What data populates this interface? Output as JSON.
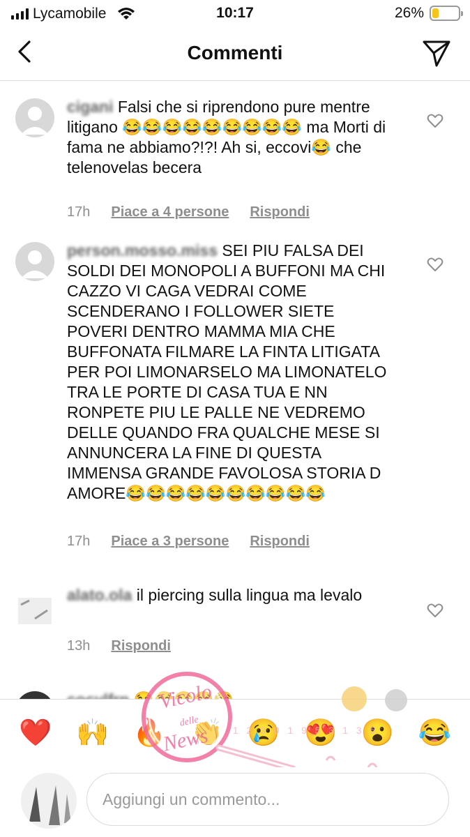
{
  "status_bar": {
    "carrier": "Lycamobile",
    "time": "10:17",
    "battery_percent": "26%",
    "battery_level": 0.26,
    "battery_color": "#f5c518"
  },
  "header": {
    "title": "Commenti",
    "back_icon": "chevron-left-icon",
    "send_icon": "paper-plane-icon"
  },
  "comments": [
    {
      "username": "cigani",
      "text": "Falsi che si riprendono pure mentre litigano 😂😂😂😂😂😂😂😂😂 ma Morti di fama ne abbiamo?!?! Ah si, eccovi😂 che telenovelas becera",
      "time": "17h",
      "likes": "Piace a 4 persone",
      "reply": "Rispondi"
    },
    {
      "username": "person.mosso.miss",
      "text": "SEI PIU FALSA  DEI SOLDI DEI MONOPOLI A BUFFONI MA CHI CAZZO VI CAGA  VEDRAI COME SCENDERANO I FOLLOWER  SIETE POVERI DENTRO MAMMA MIA  CHE BUFFONATA  FILMARE LA FINTA LITIGATA PER POI LIMONARSELO  MA LIMONATELO TRA LE PORTE DI CASA TUA E NN RONPETE PIU LE PALLE  NE VEDREMO DELLE  QUANDO FRA QUALCHE MESE  SI ANNUNCERA LA FINE DI QUESTA IMMENSA GRANDE FAVOLOSA STORIA D AMORE😂😂😂😂😂😂😂😂😂😂",
      "time": "17h",
      "likes": "Piace a 3 persone",
      "reply": "Rispondi"
    },
    {
      "username": "alato.ola",
      "text": "il piercing sulla lingua ma levalo",
      "time": "13h",
      "likes": "",
      "reply": "Rispondi"
    },
    {
      "username": "cocylfrn",
      "text": "😂😂😂😂😂",
      "time": "",
      "likes": "",
      "reply": ""
    }
  ],
  "reactions": [
    "❤️",
    "🙌",
    "🔥",
    "👏",
    "😢",
    "😍",
    "😮",
    "😂"
  ],
  "input": {
    "placeholder": "Aggiungi un commento..."
  },
  "watermark": {
    "text": "Vicolo delle News"
  }
}
